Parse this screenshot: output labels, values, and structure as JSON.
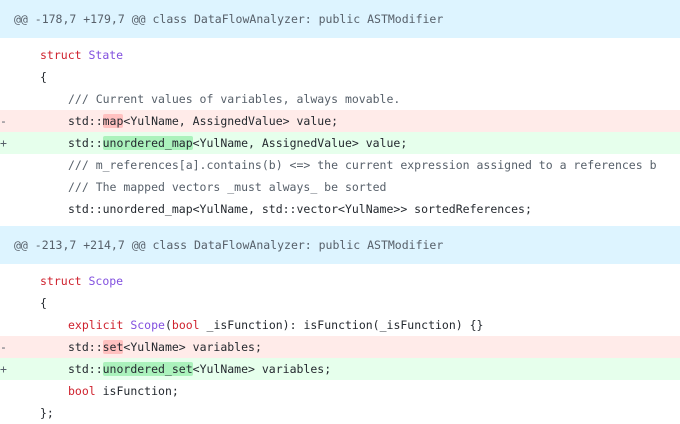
{
  "hunks": [
    {
      "header": "@@ -178,7 +179,7 @@ class DataFlowAnalyzer: public ASTModifier",
      "lines": [
        {
          "sign": " ",
          "kind": "ctx",
          "indent": 1,
          "tokens": [
            [
              "kw",
              "struct"
            ],
            [
              "txt",
              " "
            ],
            [
              "ty",
              "State"
            ]
          ]
        },
        {
          "sign": " ",
          "kind": "ctx",
          "indent": 1,
          "tokens": [
            [
              "txt",
              "{"
            ]
          ]
        },
        {
          "sign": " ",
          "kind": "ctx",
          "indent": 2,
          "tokens": [
            [
              "cm",
              "/// Current values of variables, always movable."
            ]
          ]
        },
        {
          "sign": "-",
          "kind": "del",
          "indent": 2,
          "tokens": [
            [
              "txt",
              "std::"
            ],
            [
              "hl",
              "map"
            ],
            [
              "txt",
              "<YulName, AssignedValue> value;"
            ]
          ]
        },
        {
          "sign": "+",
          "kind": "add",
          "indent": 2,
          "tokens": [
            [
              "txt",
              "std::"
            ],
            [
              "hl",
              "unordered_map"
            ],
            [
              "txt",
              "<YulName, AssignedValue> value;"
            ]
          ]
        },
        {
          "sign": " ",
          "kind": "ctx",
          "indent": 2,
          "tokens": [
            [
              "cm",
              "/// m_references[a].contains(b) <=> the current expression assigned to a references b"
            ]
          ]
        },
        {
          "sign": " ",
          "kind": "ctx",
          "indent": 2,
          "tokens": [
            [
              "cm",
              "/// The mapped vectors _must always_ be sorted"
            ]
          ]
        },
        {
          "sign": " ",
          "kind": "ctx",
          "indent": 2,
          "tokens": [
            [
              "txt",
              "std::unordered_map<YulName, std::vector<YulName>> sortedReferences;"
            ]
          ]
        }
      ]
    },
    {
      "header": "@@ -213,7 +214,7 @@ class DataFlowAnalyzer: public ASTModifier",
      "lines": [
        {
          "sign": " ",
          "kind": "ctx",
          "indent": 1,
          "tokens": [
            [
              "kw",
              "struct"
            ],
            [
              "txt",
              " "
            ],
            [
              "ty",
              "Scope"
            ]
          ]
        },
        {
          "sign": " ",
          "kind": "ctx",
          "indent": 1,
          "tokens": [
            [
              "txt",
              "{"
            ]
          ]
        },
        {
          "sign": " ",
          "kind": "ctx",
          "indent": 2,
          "tokens": [
            [
              "kw",
              "explicit"
            ],
            [
              "txt",
              " "
            ],
            [
              "ty",
              "Scope"
            ],
            [
              "txt",
              "("
            ],
            [
              "kw",
              "bool"
            ],
            [
              "txt",
              " _isFunction): isFunction(_isFunction) {}"
            ]
          ]
        },
        {
          "sign": "-",
          "kind": "del",
          "indent": 2,
          "tokens": [
            [
              "txt",
              "std::"
            ],
            [
              "hl",
              "set"
            ],
            [
              "txt",
              "<YulName> variables;"
            ]
          ]
        },
        {
          "sign": "+",
          "kind": "add",
          "indent": 2,
          "tokens": [
            [
              "txt",
              "std::"
            ],
            [
              "hl",
              "unordered_set"
            ],
            [
              "txt",
              "<YulName> variables;"
            ]
          ]
        },
        {
          "sign": " ",
          "kind": "ctx",
          "indent": 2,
          "tokens": [
            [
              "kw",
              "bool"
            ],
            [
              "txt",
              " isFunction;"
            ]
          ]
        },
        {
          "sign": " ",
          "kind": "ctx",
          "indent": 1,
          "tokens": [
            [
              "txt",
              "};"
            ]
          ]
        }
      ]
    }
  ]
}
